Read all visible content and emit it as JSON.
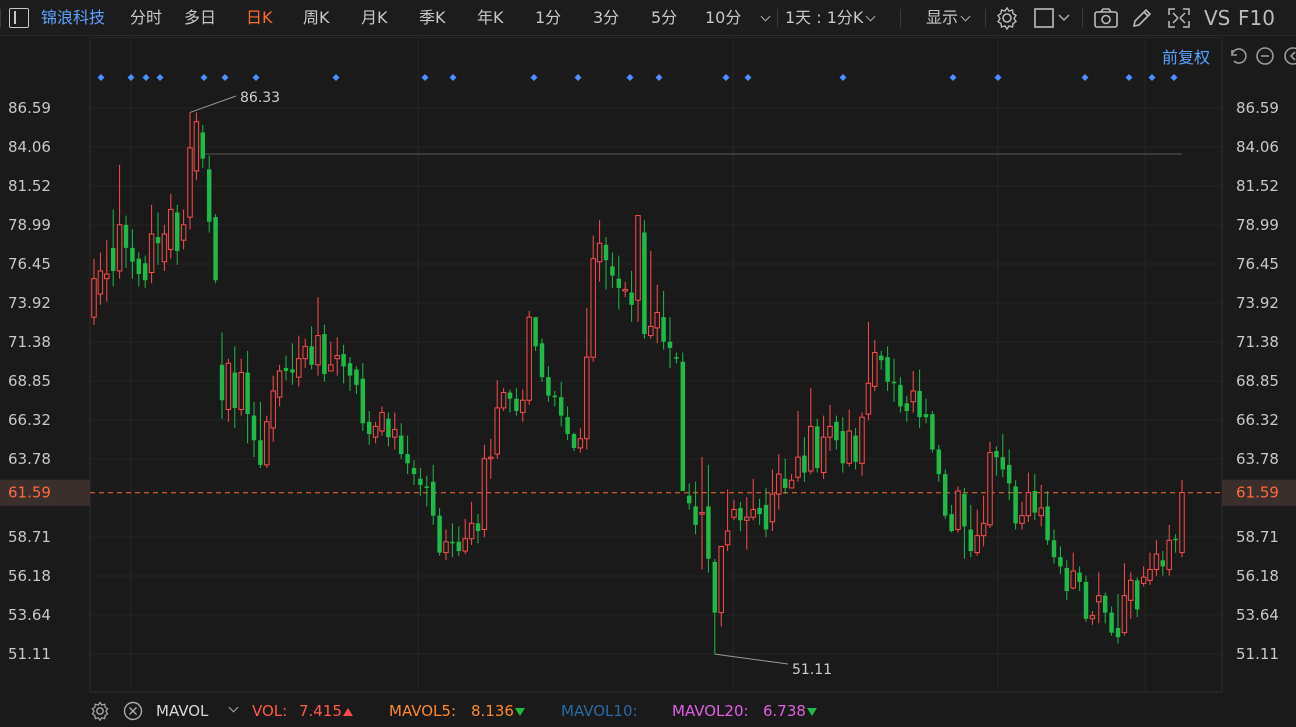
{
  "toolbar": {
    "stock_name": "锦浪科技",
    "tabs": [
      "分时",
      "多日",
      "日K",
      "周K",
      "月K",
      "季K",
      "年K",
      "1分",
      "3分",
      "5分",
      "10分"
    ],
    "active_tab": "日K",
    "period_select": "1天 : 1分K",
    "display_label": "显示",
    "vs_label": "VS",
    "f10_label": "F10"
  },
  "chart_header": {
    "adjust_label": "前复权"
  },
  "chart_data": {
    "type": "candlestick",
    "y_ticks": [
      "86.59",
      "84.06",
      "81.52",
      "78.99",
      "76.45",
      "73.92",
      "71.38",
      "68.85",
      "66.32",
      "63.78",
      "61.59",
      "58.71",
      "56.18",
      "53.64",
      "51.11"
    ],
    "current_price": "61.59",
    "high_annotation": "86.33",
    "low_annotation": "51.11",
    "ylim": [
      51.11,
      86.59
    ],
    "colors": {
      "up": "#ff4b4b",
      "down": "#1dba46",
      "current": "#ff6a3a",
      "marker": "#4a90ff"
    }
  },
  "indicator_bar": {
    "name": "MAVOL",
    "vol_label": "VOL:",
    "vol_value": "7.415",
    "mavol5_label": "MAVOL5:",
    "mavol5_value": "8.136",
    "mavol10_label": "MAVOL10:",
    "mavol20_label": "MAVOL20:",
    "mavol20_value": "6.738"
  }
}
